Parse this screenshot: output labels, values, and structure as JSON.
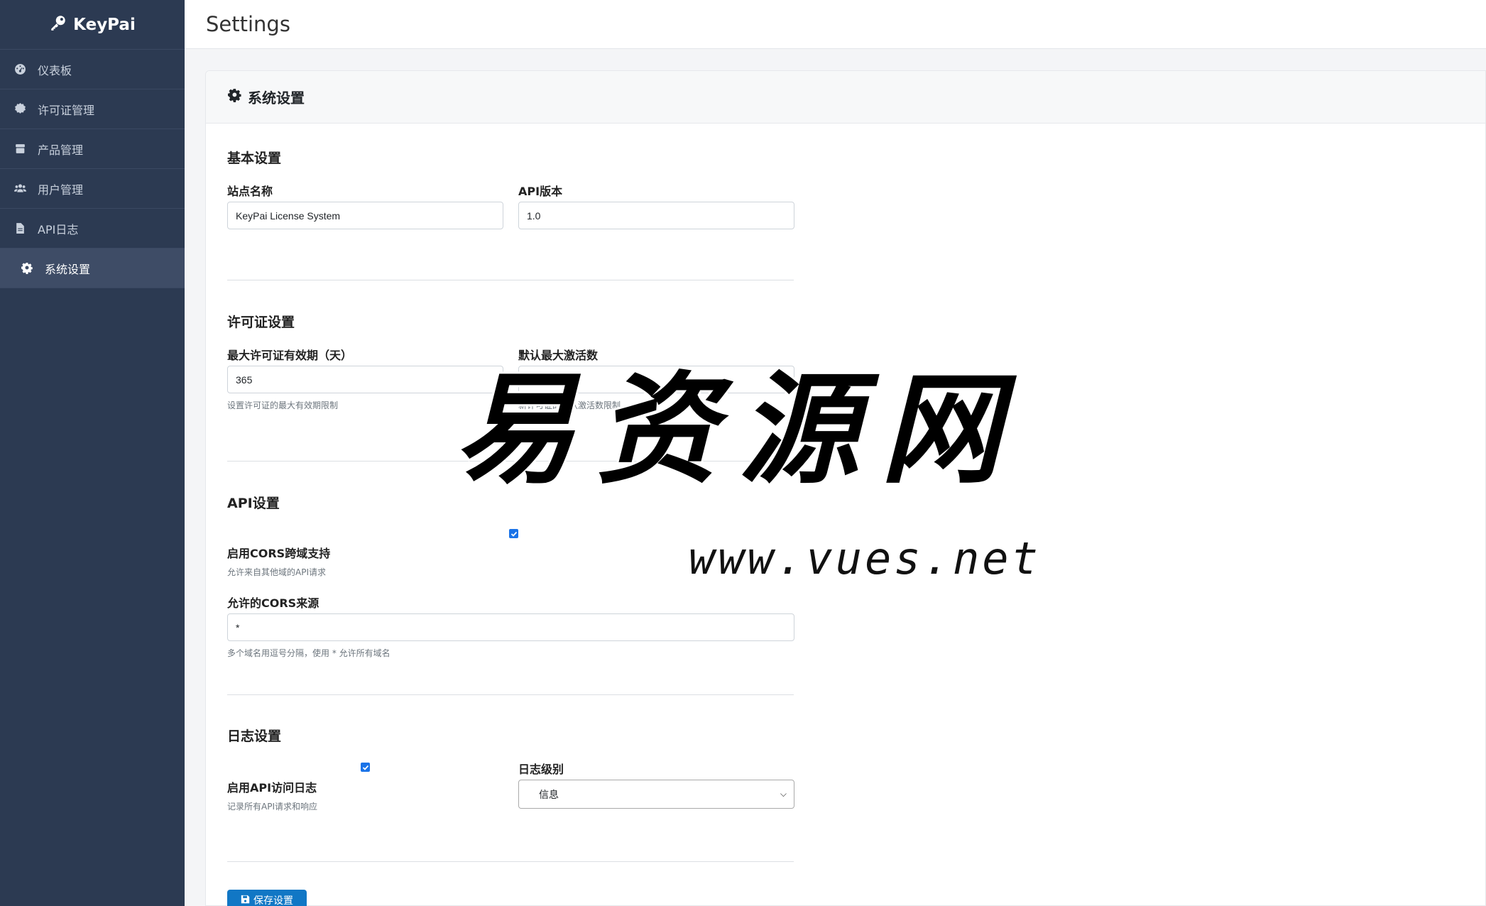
{
  "sidebar": {
    "brand": "KeyPai",
    "items": [
      {
        "label": "仪表板",
        "icon": "dashboard-icon"
      },
      {
        "label": "许可证管理",
        "icon": "certificate-icon"
      },
      {
        "label": "产品管理",
        "icon": "box-icon"
      },
      {
        "label": "用户管理",
        "icon": "users-icon"
      },
      {
        "label": "API日志",
        "icon": "file-icon"
      },
      {
        "label": "系统设置",
        "icon": "gear-icon",
        "active": true
      }
    ]
  },
  "header": {
    "title": "Settings"
  },
  "card": {
    "title": "系统设置",
    "basic": {
      "title": "基本设置",
      "site_name_label": "站点名称",
      "site_name_value": "KeyPai License System",
      "api_version_label": "API版本",
      "api_version_value": "1.0"
    },
    "license": {
      "title": "许可证设置",
      "max_validity_label": "最大许可证有效期（天）",
      "max_validity_value": "365",
      "max_validity_hint": "设置许可证的最大有效期限制",
      "default_activations_label": "默认最大激活数",
      "default_activations_value": "1",
      "default_activations_hint": "新许可证的默认激活数限制"
    },
    "api": {
      "title": "API设置",
      "cors_enable_label": "启用CORS跨域支持",
      "cors_enable_checked": true,
      "cors_enable_hint": "允许来自其他域的API请求",
      "cors_origins_label": "允许的CORS来源",
      "cors_origins_value": "*",
      "cors_origins_hint": "多个域名用逗号分隔，使用 * 允许所有域名"
    },
    "log": {
      "title": "日志设置",
      "api_log_label": "启用API访问日志",
      "api_log_checked": true,
      "api_log_hint": "记录所有API请求和响应",
      "level_label": "日志级别",
      "level_value": "信息"
    },
    "save_button": "保存设置"
  },
  "watermark": {
    "text": "易资源网",
    "url": "www.vues.net"
  },
  "colors": {
    "sidebar_bg": "#2c3a52",
    "sidebar_active": "#3e4c66",
    "primary": "#1177c5",
    "checkbox": "#1a73e8"
  }
}
